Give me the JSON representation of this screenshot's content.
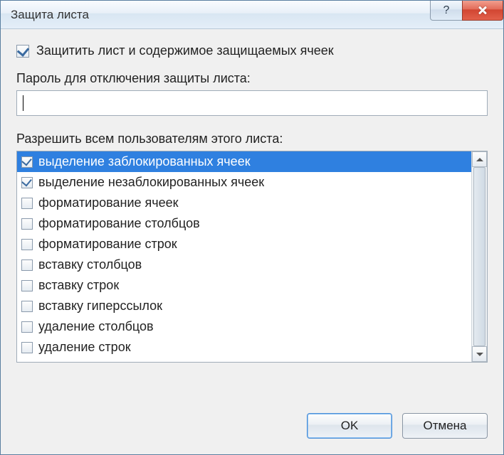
{
  "title": "Защита листа",
  "protect": {
    "checked": true,
    "label": "Защитить лист и содержимое защищаемых ячеек"
  },
  "password": {
    "label": "Пароль для отключения защиты листа:",
    "value": ""
  },
  "permissions": {
    "label": "Разрешить всем пользователям этого листа:",
    "items": [
      {
        "label": "выделение заблокированных ячеек",
        "checked": true,
        "selected": true
      },
      {
        "label": "выделение незаблокированных ячеек",
        "checked": true,
        "selected": false
      },
      {
        "label": "форматирование ячеек",
        "checked": false,
        "selected": false
      },
      {
        "label": "форматирование столбцов",
        "checked": false,
        "selected": false
      },
      {
        "label": "форматирование строк",
        "checked": false,
        "selected": false
      },
      {
        "label": "вставку столбцов",
        "checked": false,
        "selected": false
      },
      {
        "label": "вставку строк",
        "checked": false,
        "selected": false
      },
      {
        "label": "вставку гиперссылок",
        "checked": false,
        "selected": false
      },
      {
        "label": "удаление столбцов",
        "checked": false,
        "selected": false
      },
      {
        "label": "удаление строк",
        "checked": false,
        "selected": false
      }
    ]
  },
  "buttons": {
    "ok": "OK",
    "cancel": "Отмена",
    "help": "?"
  }
}
